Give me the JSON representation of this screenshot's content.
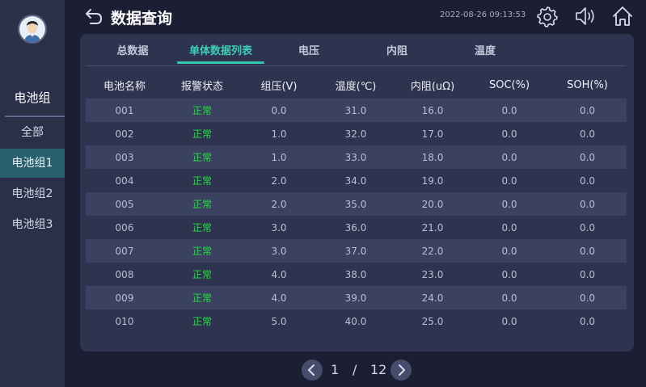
{
  "header": {
    "title": "数据查询",
    "timestamp": "2022-08-26 09:13:53"
  },
  "sidebar": {
    "title": "电池组",
    "items": [
      {
        "label": "全部",
        "active": false
      },
      {
        "label": "电池组1",
        "active": true
      },
      {
        "label": "电池组2",
        "active": false
      },
      {
        "label": "电池组3",
        "active": false
      }
    ]
  },
  "tabs": [
    {
      "label": "总数据",
      "active": false
    },
    {
      "label": "单体数据列表",
      "active": true
    },
    {
      "label": "电压",
      "active": false
    },
    {
      "label": "内阻",
      "active": false
    },
    {
      "label": "温度",
      "active": false
    }
  ],
  "table": {
    "columns": [
      "电池名称",
      "报警状态",
      "组压(V)",
      "温度(℃)",
      "内阻(uΩ)",
      "SOC(%)",
      "SOH(%)"
    ],
    "rows": [
      [
        "001",
        "正常",
        "0.0",
        "31.0",
        "16.0",
        "0.0",
        "0.0"
      ],
      [
        "002",
        "正常",
        "1.0",
        "32.0",
        "17.0",
        "0.0",
        "0.0"
      ],
      [
        "003",
        "正常",
        "1.0",
        "33.0",
        "18.0",
        "0.0",
        "0.0"
      ],
      [
        "004",
        "正常",
        "2.0",
        "34.0",
        "19.0",
        "0.0",
        "0.0"
      ],
      [
        "005",
        "正常",
        "2.0",
        "35.0",
        "20.0",
        "0.0",
        "0.0"
      ],
      [
        "006",
        "正常",
        "3.0",
        "36.0",
        "21.0",
        "0.0",
        "0.0"
      ],
      [
        "007",
        "正常",
        "3.0",
        "37.0",
        "22.0",
        "0.0",
        "0.0"
      ],
      [
        "008",
        "正常",
        "4.0",
        "38.0",
        "23.0",
        "0.0",
        "0.0"
      ],
      [
        "009",
        "正常",
        "4.0",
        "39.0",
        "24.0",
        "0.0",
        "0.0"
      ],
      [
        "010",
        "正常",
        "5.0",
        "40.0",
        "25.0",
        "0.0",
        "0.0"
      ]
    ]
  },
  "pagination": {
    "current": "1",
    "separator": "/",
    "total": "12"
  },
  "icons": {
    "back": "back-arrow-icon",
    "settings": "gear-icon",
    "sound": "speaker-icon",
    "home": "home-icon",
    "prev": "chevron-left-icon",
    "next": "chevron-right-icon"
  },
  "colors": {
    "accent": "#33c7b0",
    "status_ok": "#22e03a",
    "sidebar_active": "#2a5f6e"
  }
}
